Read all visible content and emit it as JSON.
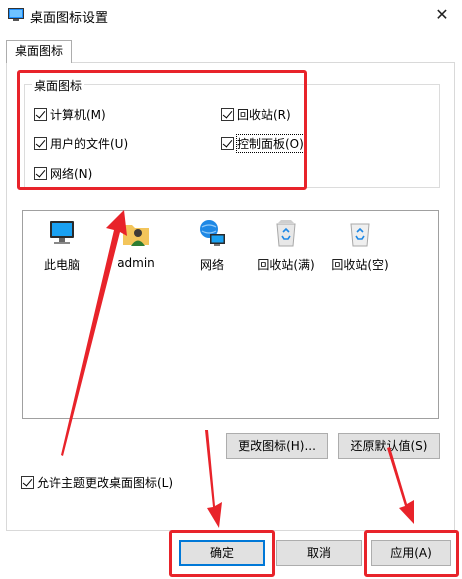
{
  "window": {
    "title": "桌面图标设置",
    "close": "✕"
  },
  "tab": {
    "label": "桌面图标"
  },
  "group": {
    "legend": "桌面图标",
    "checkboxes": [
      {
        "label": "计算机(M)",
        "checked": true
      },
      {
        "label": "回收站(R)",
        "checked": true
      },
      {
        "label": "用户的文件(U)",
        "checked": true
      },
      {
        "label": "控制面板(O)",
        "checked": true
      },
      {
        "label": "网络(N)",
        "checked": true
      }
    ]
  },
  "icons": [
    {
      "label": "此电脑",
      "icon": "computer-icon"
    },
    {
      "label": "admin",
      "icon": "user-folder-icon"
    },
    {
      "label": "网络",
      "icon": "network-icon"
    },
    {
      "label": "回收站(满)",
      "icon": "recycle-bin-full-icon"
    },
    {
      "label": "回收站(空)",
      "icon": "recycle-bin-empty-icon"
    }
  ],
  "buttons": {
    "change_icon": "更改图标(H)...",
    "restore_default": "还原默认值(S)",
    "ok": "确定",
    "cancel": "取消",
    "apply": "应用(A)"
  },
  "allow_themes": {
    "label": "允许主题更改桌面图标(L)",
    "checked": true
  },
  "colors": {
    "annotation": "#e8232a",
    "accent": "#0078d7"
  }
}
